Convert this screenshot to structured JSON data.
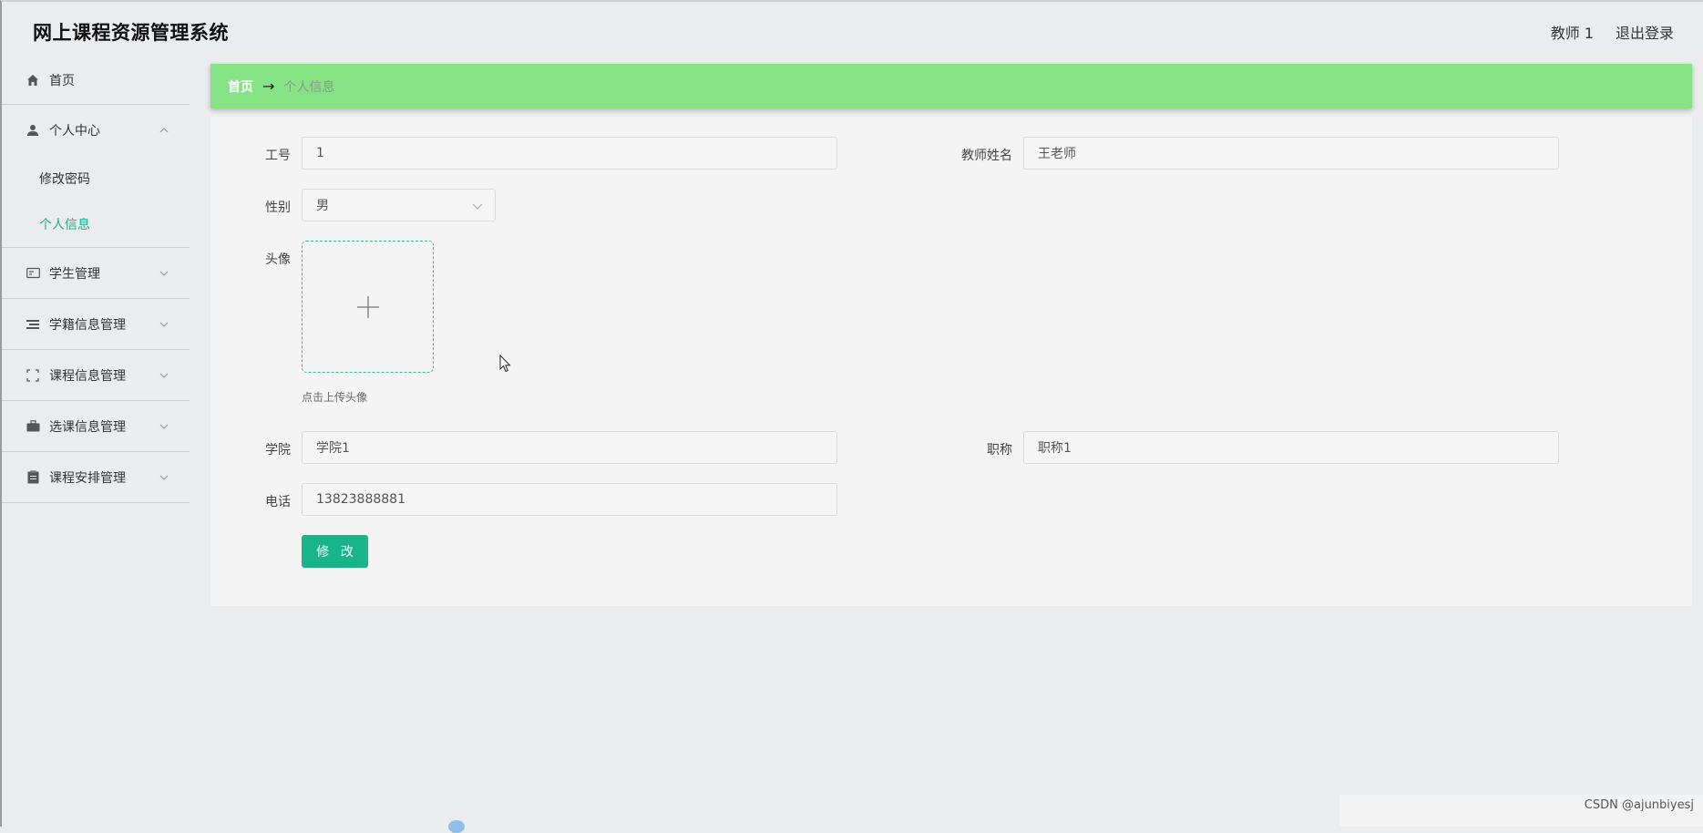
{
  "header": {
    "title": "网上课程资源管理系统",
    "user": "教师 1",
    "logout": "退出登录"
  },
  "sidebar": {
    "items": [
      {
        "label": "首页",
        "icon": "home-icon"
      },
      {
        "label": "个人中心",
        "icon": "user-icon",
        "expanded": true,
        "children": [
          {
            "label": "修改密码"
          },
          {
            "label": "个人信息",
            "active": true
          }
        ]
      },
      {
        "label": "学生管理",
        "icon": "id-card-icon"
      },
      {
        "label": "学籍信息管理",
        "icon": "list-icon"
      },
      {
        "label": "课程信息管理",
        "icon": "fullscreen-icon"
      },
      {
        "label": "选课信息管理",
        "icon": "briefcase-icon"
      },
      {
        "label": "课程安排管理",
        "icon": "clipboard-icon"
      }
    ]
  },
  "breadcrumb": {
    "home": "首页",
    "arrow": "→",
    "current": "个人信息"
  },
  "form": {
    "employee_id": {
      "label": "工号",
      "value": "1"
    },
    "teacher_name": {
      "label": "教师姓名",
      "value": "王老师"
    },
    "gender": {
      "label": "性别",
      "value": "男"
    },
    "avatar": {
      "label": "头像",
      "hint": "点击上传头像"
    },
    "college": {
      "label": "学院",
      "value": "学院1"
    },
    "title": {
      "label": "职称",
      "value": "职称1"
    },
    "phone": {
      "label": "电话",
      "value": "13823888881"
    },
    "submit": "修 改"
  },
  "watermark": "CSDN @ajunbiyesj",
  "colors": {
    "accent": "#1ab48a",
    "breadcrumb_bg": "#86e386",
    "active_menu": "#1fae8e"
  }
}
